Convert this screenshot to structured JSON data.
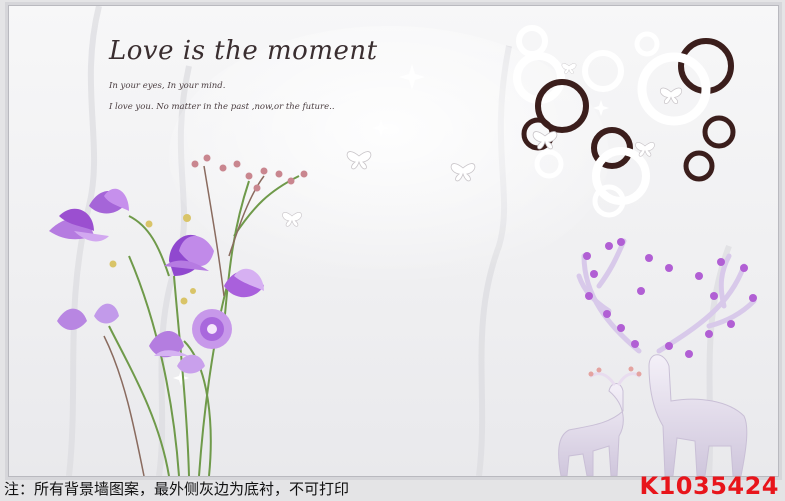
{
  "wallpaper": {
    "headline": "Love is the moment",
    "subline_1": "In your eyes, In your mind.",
    "subline_2": "I love you. No matter in the past ,now,or the future.."
  },
  "footer": {
    "note": "注：所有背景墙图案，最外侧灰边为底衬，不可打印",
    "product_code": "K1035424"
  },
  "colors": {
    "border_gray": "#d6d6da",
    "code_red": "#e8151b",
    "flower_purple": "#9b4fd0",
    "ring_dark": "#3b1e1c"
  }
}
